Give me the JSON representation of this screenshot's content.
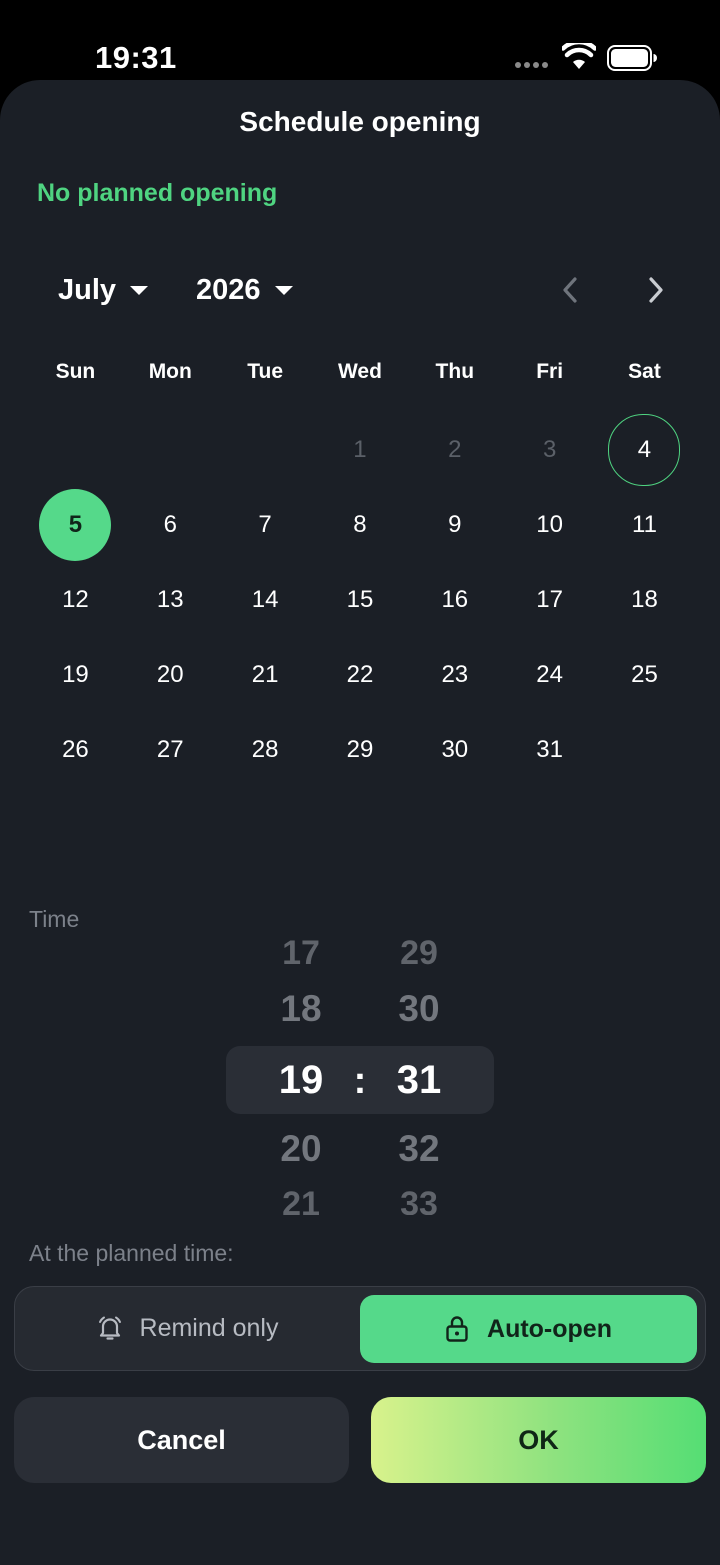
{
  "status_bar": {
    "time": "19:31"
  },
  "sheet": {
    "title": "Schedule opening",
    "plan_status": "No planned opening"
  },
  "calendar": {
    "month": "July",
    "year": "2026",
    "weekdays": [
      "Sun",
      "Mon",
      "Tue",
      "Wed",
      "Thu",
      "Fri",
      "Sat"
    ],
    "leading_blank_days": 3,
    "days": [
      {
        "label": "1",
        "muted": true
      },
      {
        "label": "2",
        "muted": true
      },
      {
        "label": "3",
        "muted": true
      },
      {
        "label": "4",
        "today": true
      },
      {
        "label": "5",
        "selected": true
      },
      {
        "label": "6"
      },
      {
        "label": "7"
      },
      {
        "label": "8"
      },
      {
        "label": "9"
      },
      {
        "label": "10"
      },
      {
        "label": "11"
      },
      {
        "label": "12"
      },
      {
        "label": "13"
      },
      {
        "label": "14"
      },
      {
        "label": "15"
      },
      {
        "label": "16"
      },
      {
        "label": "17"
      },
      {
        "label": "18"
      },
      {
        "label": "19"
      },
      {
        "label": "20"
      },
      {
        "label": "21"
      },
      {
        "label": "22"
      },
      {
        "label": "23"
      },
      {
        "label": "24"
      },
      {
        "label": "25"
      },
      {
        "label": "26"
      },
      {
        "label": "27"
      },
      {
        "label": "28"
      },
      {
        "label": "29"
      },
      {
        "label": "30"
      },
      {
        "label": "31"
      }
    ]
  },
  "time_picker": {
    "label": "Time",
    "separator": ":",
    "hours": [
      "17",
      "18",
      "19",
      "20",
      "21"
    ],
    "minutes": [
      "29",
      "30",
      "31",
      "32",
      "33"
    ],
    "selected_hour": "19",
    "selected_minute": "31"
  },
  "mode": {
    "label": "At the planned time:",
    "remind_label": "Remind only",
    "auto_label": "Auto-open",
    "selected": "auto-open",
    "remind_icon": "bell-icon",
    "auto_icon": "lock-icon"
  },
  "actions": {
    "cancel_label": "Cancel",
    "ok_label": "OK"
  },
  "colors": {
    "accent": "#55d98a",
    "background": "#1b1f26",
    "status_text": "#4fd481"
  }
}
